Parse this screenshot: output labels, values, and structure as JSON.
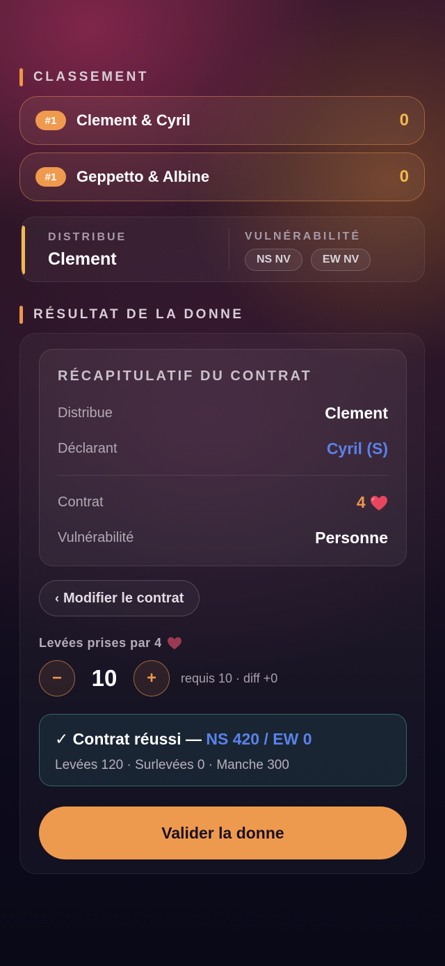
{
  "ranking": {
    "title": "CLASSEMENT",
    "items": [
      {
        "rank": "#1",
        "name": "Clement & Cyril",
        "score": "0"
      },
      {
        "rank": "#1",
        "name": "Geppetto & Albine",
        "score": "0"
      }
    ]
  },
  "dealer": {
    "label": "DISTRIBUE",
    "name": "Clement",
    "vuln_label": "VULNÉRABILITÉ",
    "vuln_pills": [
      "NS NV",
      "EW NV"
    ]
  },
  "result": {
    "title": "RÉSULTAT DE LA DONNE",
    "recap": {
      "title": "RÉCAPITULATIF DU CONTRAT",
      "distribue_label": "Distribue",
      "distribue_value": "Clement",
      "declarant_label": "Déclarant",
      "declarant_value": "Cyril (S)",
      "contrat_label": "Contrat",
      "contrat_value": "4",
      "vuln_label": "Vulnérabilité",
      "vuln_value": "Personne"
    },
    "modify_label": "Modifier le contrat",
    "tricks_label": "Levées prises par 4",
    "tricks_minus": "−",
    "tricks_value": "10",
    "tricks_plus": "+",
    "tricks_info": "requis 10 · diff +0",
    "success": {
      "prefix": "✓ Contrat réussi — ",
      "score": "NS 420 / EW 0",
      "detail": "Levées 120 · Surlevées 0 · Manche 300"
    },
    "validate_label": "Valider la donne"
  },
  "colors": {
    "accent": "#ee9a4e",
    "blue": "#5a82e8",
    "gold": "#f2b94e",
    "heart": "#e8455e"
  }
}
